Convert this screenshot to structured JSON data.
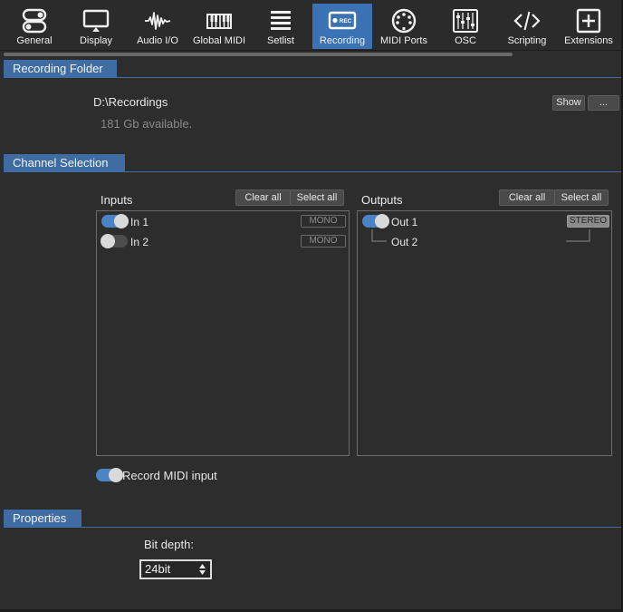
{
  "tabs": [
    {
      "label": "General",
      "icon": "toggles-icon",
      "active": false
    },
    {
      "label": "Display",
      "icon": "monitor-icon",
      "active": false
    },
    {
      "label": "Audio I/O",
      "icon": "waveform-icon",
      "active": false
    },
    {
      "label": "Global MIDI",
      "icon": "piano-keys-icon",
      "active": false
    },
    {
      "label": "Setlist",
      "icon": "list-icon",
      "active": false
    },
    {
      "label": "Recording",
      "icon": "rec-icon",
      "active": true
    },
    {
      "label": "MIDI Ports",
      "icon": "din-connector-icon",
      "active": false
    },
    {
      "label": "OSC",
      "icon": "mixer-faders-icon",
      "active": false
    },
    {
      "label": "Scripting",
      "icon": "code-icon",
      "active": false
    },
    {
      "label": "Extensions",
      "icon": "plus-box-icon",
      "active": false
    }
  ],
  "rec_icon_text": "REC",
  "recording_folder": {
    "title": "Recording Folder",
    "path": "D:\\Recordings",
    "available": "181 Gb available.",
    "show_label": "Show",
    "browse_label": "..."
  },
  "channel_selection": {
    "title": "Channel Selection",
    "inputs": {
      "title": "Inputs",
      "clear_label": "Clear all",
      "select_label": "Select all",
      "channels": [
        {
          "name": "In 1",
          "enabled": true,
          "mode": "MONO"
        },
        {
          "name": "In 2",
          "enabled": false,
          "mode": "MONO"
        }
      ]
    },
    "outputs": {
      "title": "Outputs",
      "clear_label": "Clear all",
      "select_label": "Select all",
      "channels": [
        {
          "name": "Out 1",
          "enabled": true,
          "mode": "STEREO"
        },
        {
          "name": "Out 2"
        }
      ]
    },
    "record_midi": {
      "label": "Record MIDI input",
      "enabled": true
    }
  },
  "properties": {
    "title": "Properties",
    "bit_depth_label": "Bit depth:",
    "bit_depth_value": "24bit"
  },
  "colors": {
    "accent": "#3f6da3",
    "toggle_on": "#4a84c4",
    "background": "#2d2d2d"
  }
}
